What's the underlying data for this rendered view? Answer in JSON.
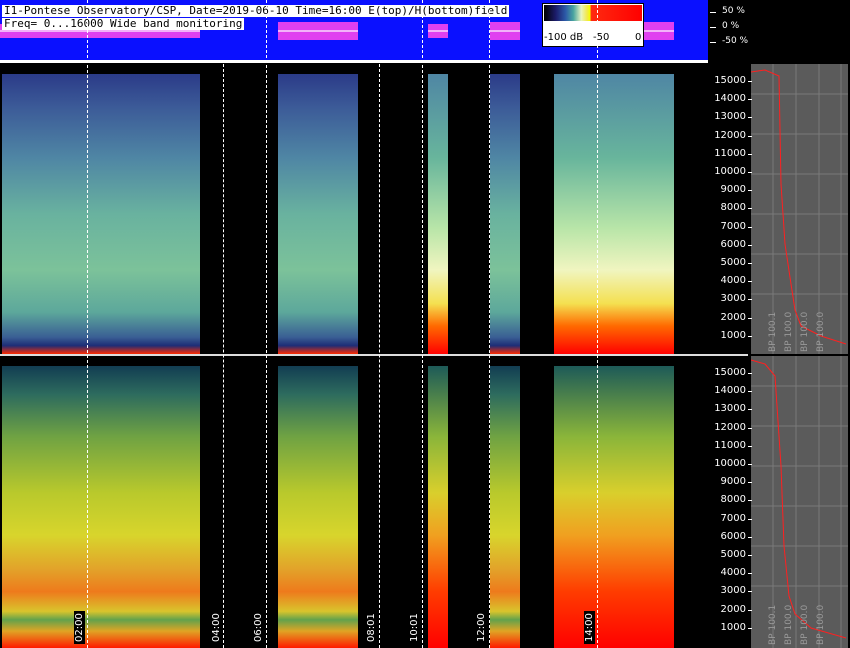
{
  "header": {
    "line1": "I1-Pontese Observatory/CSP, Date=2019-06-10 Time=16:00 E(top)/H(bottom)field",
    "line2": "Freq= 0...16000 Wide band monitoring"
  },
  "amplitude_axis": [
    "50 %",
    "0 %",
    "-50 %"
  ],
  "color_scale": {
    "labels": [
      "-100 dB",
      "-50",
      "0"
    ]
  },
  "frequency_ticks": [
    "15000",
    "14000",
    "13000",
    "12000",
    "11000",
    "10000",
    "9000",
    "8000",
    "7000",
    "6000",
    "5000",
    "4000",
    "3000",
    "2000",
    "1000"
  ],
  "time_labels": [
    "02:00",
    "04:00",
    "06:00",
    "08:01",
    "10:01",
    "12:00",
    "14:00"
  ],
  "side_graph_labels": [
    "BP 100.1",
    "BP 100.0",
    "BP 100.0",
    "BP 100.0"
  ],
  "colors": {
    "wave_bg": "#0a10ff",
    "trace": "#ff00ff",
    "curve": "#ff2020"
  }
}
